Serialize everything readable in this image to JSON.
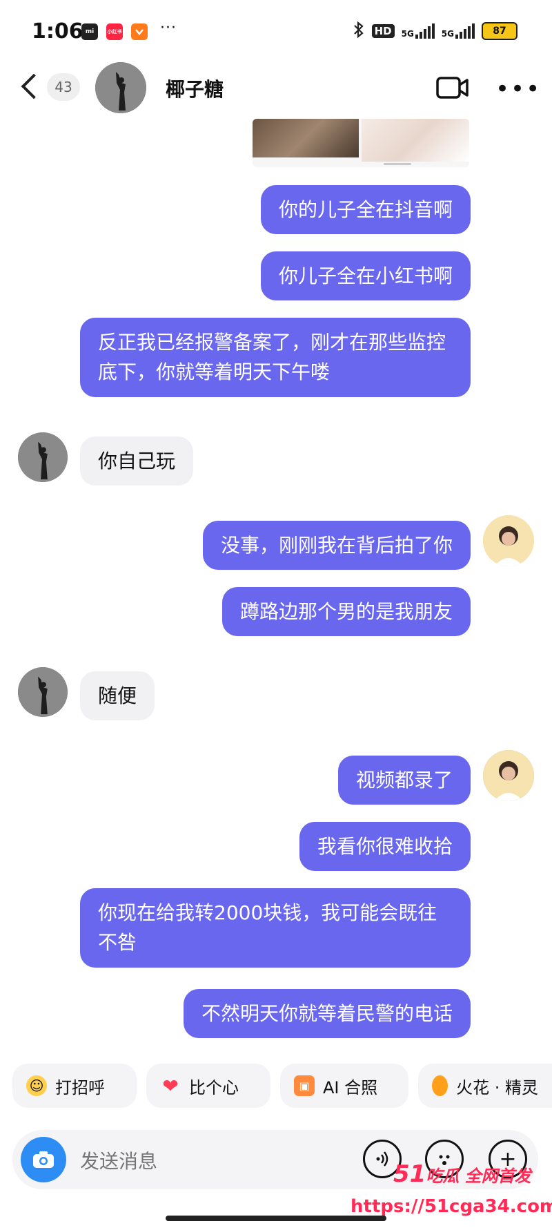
{
  "status_bar": {
    "time": "1:06",
    "apps": [
      {
        "icon": "mi-icon",
        "label": "mi",
        "color": "#222222"
      },
      {
        "icon": "xiaohongshu-icon",
        "label": "小红书",
        "color": "#ff2442"
      },
      {
        "icon": "taobao-icon",
        "label": "",
        "color": "#ff7a1a"
      }
    ],
    "more": "···",
    "hd": "HD",
    "net1": "5G",
    "net2": "5G",
    "battery": "87"
  },
  "header": {
    "unread_count": "43",
    "contact_name": "椰子糖"
  },
  "messages": [
    {
      "side": "sent",
      "text": "你的儿子全在抖音啊"
    },
    {
      "side": "sent",
      "text": "你儿子全在小红书啊"
    },
    {
      "side": "sent",
      "text": "反正我已经报警备案了，刚才在那些监控底下，你就等着明天下午喽"
    },
    {
      "side": "recv",
      "text": "你自己玩"
    },
    {
      "side": "sent",
      "text": "没事，刚刚我在背后拍了你"
    },
    {
      "side": "sent",
      "text": "蹲路边那个男的是我朋友"
    },
    {
      "side": "recv",
      "text": "随便"
    },
    {
      "side": "sent",
      "text": "视频都录了"
    },
    {
      "side": "sent",
      "text": "我看你很难收拾"
    },
    {
      "side": "sent",
      "text": "你现在给我转2000块钱，我可能会既往不咎"
    },
    {
      "side": "sent",
      "text": "不然明天你就等着民警的电话"
    }
  ],
  "quick_replies": [
    {
      "icon": "wave-emoji-icon",
      "label": "打招呼"
    },
    {
      "icon": "heart-icon",
      "label": "比个心"
    },
    {
      "icon": "ai-photo-icon",
      "label": "AI 合照"
    },
    {
      "icon": "spark-icon",
      "label": "火花 · 精灵"
    }
  ],
  "input": {
    "placeholder": "发送消息"
  },
  "watermark": {
    "line1_num": "51",
    "line1_text": "吃瓜 全网首发",
    "line2": "https://51cga34.com"
  },
  "colors": {
    "sent_bubble": "#6a67ef",
    "recv_bubble": "#f1f1f3",
    "camera_button": "#2d8df5",
    "watermark": "#ff2a55"
  }
}
